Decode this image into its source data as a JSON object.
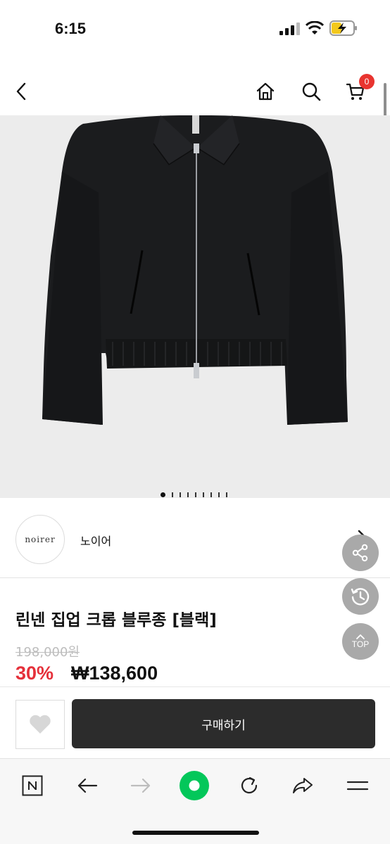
{
  "status_bar": {
    "time": "6:15"
  },
  "header": {
    "back_icon": "chevron-left-icon",
    "home_icon": "home-icon",
    "search_icon": "search-icon",
    "cart_icon": "cart-icon",
    "cart_count": "0"
  },
  "gallery": {
    "total_images": 9,
    "active_index": 0
  },
  "brand": {
    "logo_text": "noirer",
    "name": "노이어"
  },
  "floating": {
    "share_icon": "share-icon",
    "history_icon": "history-icon",
    "top_label": "TOP"
  },
  "product": {
    "title": "린넨 집업 크롭 블루종 [블랙]",
    "original_price": "198,000원",
    "discount": "30%",
    "sale_price": "₩138,600"
  },
  "purchase": {
    "wish_icon": "heart-icon",
    "buy_label": "구매하기"
  },
  "browser_toolbar": {
    "icons": [
      "naver-n-icon",
      "back-arrow-icon",
      "forward-arrow-icon",
      "green-dot-icon",
      "reload-icon",
      "share-icon",
      "menu-icon"
    ]
  },
  "colors": {
    "accent_red": "#e5303a",
    "badge_red": "#e8342f",
    "buy_bg": "#2c2c2c",
    "naver_green": "#03c75a"
  }
}
